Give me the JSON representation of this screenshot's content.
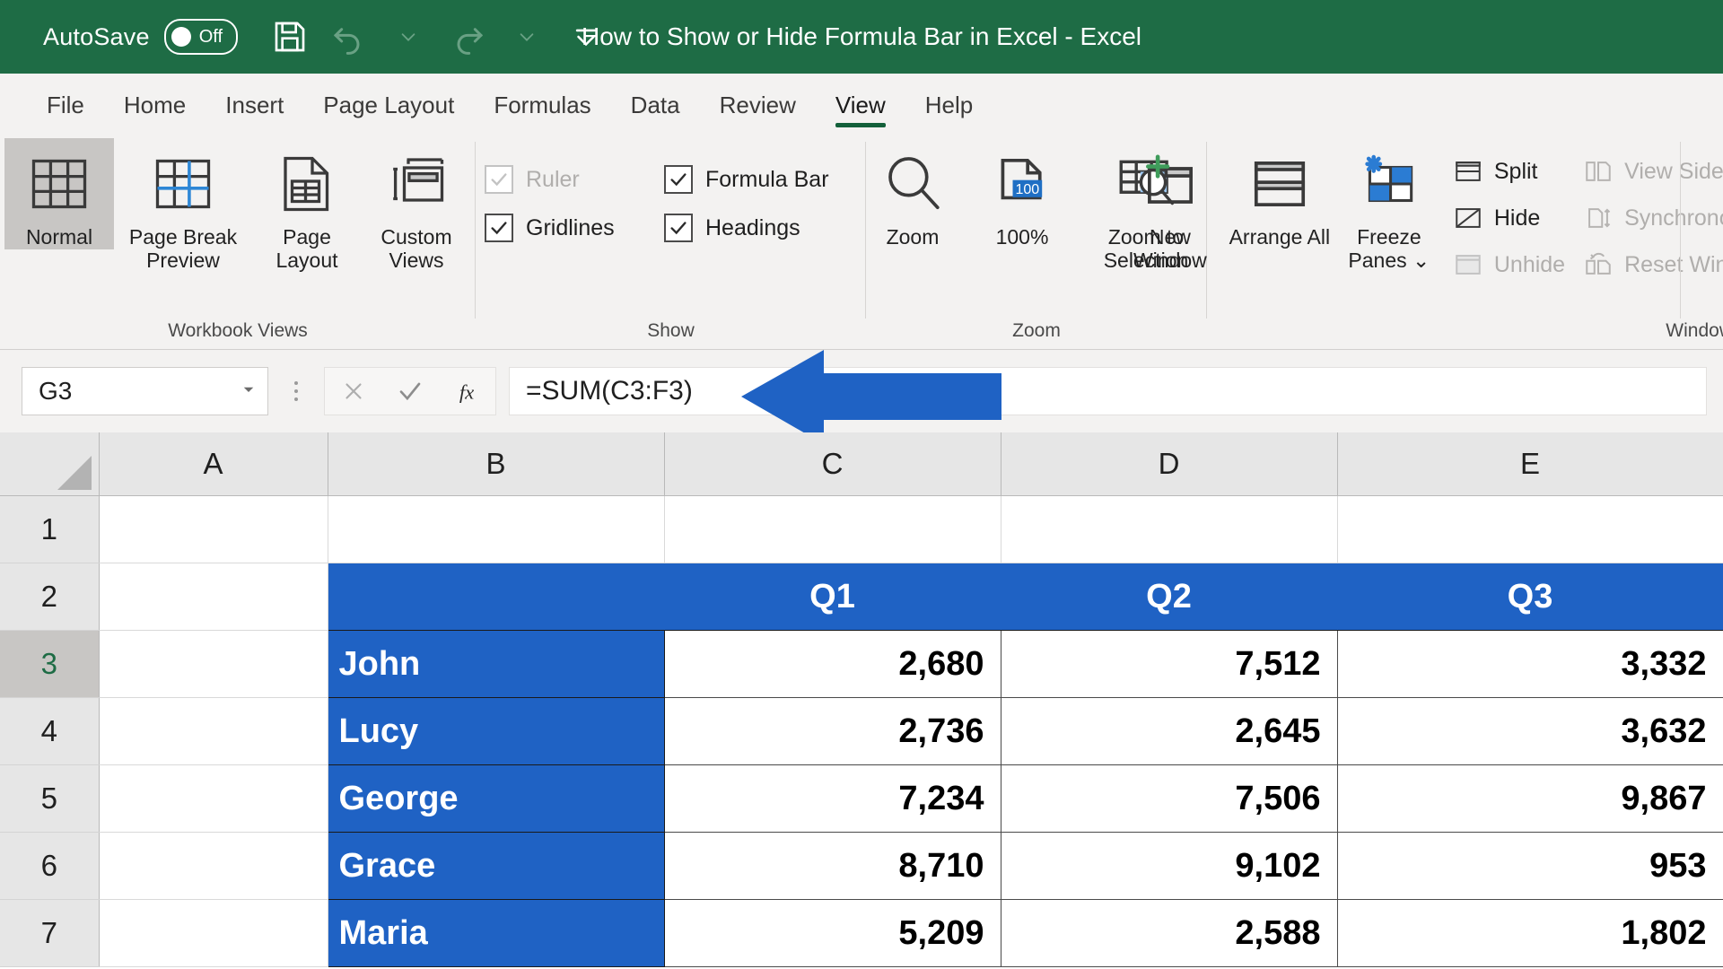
{
  "titlebar": {
    "autosave_label": "AutoSave",
    "autosave_state": "Off",
    "document_title": "How to Show or Hide Formula Bar in Excel  -  Excel",
    "quick_access": [
      {
        "name": "save-icon",
        "label": "Save"
      },
      {
        "name": "undo-icon",
        "label": "Undo"
      },
      {
        "name": "undo-dropdown-icon",
        "label": "Undo options"
      },
      {
        "name": "redo-icon",
        "label": "Redo"
      },
      {
        "name": "redo-dropdown-icon",
        "label": "Redo options"
      },
      {
        "name": "customize-quick-access-icon",
        "label": "Customize Quick Access Toolbar"
      }
    ],
    "accent_green": "#1e6c45"
  },
  "tabs": [
    {
      "label": "File",
      "active": false
    },
    {
      "label": "Home",
      "active": false
    },
    {
      "label": "Insert",
      "active": false
    },
    {
      "label": "Page Layout",
      "active": false
    },
    {
      "label": "Formulas",
      "active": false
    },
    {
      "label": "Data",
      "active": false
    },
    {
      "label": "Review",
      "active": false
    },
    {
      "label": "View",
      "active": true
    },
    {
      "label": "Help",
      "active": false
    }
  ],
  "ribbon": {
    "active_tab_underline_color": "#13603a",
    "groups": {
      "workbook_views": {
        "label": "Workbook Views",
        "buttons": [
          {
            "label": "Normal",
            "selected": true
          },
          {
            "label": "Page Break Preview",
            "selected": false
          },
          {
            "label": "Page Layout",
            "selected": false
          },
          {
            "label": "Custom Views",
            "selected": false
          }
        ]
      },
      "show": {
        "label": "Show",
        "checkboxes": [
          {
            "label": "Ruler",
            "checked": true,
            "disabled": true
          },
          {
            "label": "Formula Bar",
            "checked": true,
            "disabled": false
          },
          {
            "label": "Gridlines",
            "checked": true,
            "disabled": false
          },
          {
            "label": "Headings",
            "checked": true,
            "disabled": false
          }
        ]
      },
      "zoom": {
        "label": "Zoom",
        "buttons": [
          {
            "label": "Zoom"
          },
          {
            "label": "100%"
          },
          {
            "label": "Zoom to Selection"
          }
        ],
        "zoom_badge": "100"
      },
      "window": {
        "label": "Window",
        "big_buttons": [
          {
            "label": "New Window"
          },
          {
            "label": "Arrange All"
          },
          {
            "label": "Freeze Panes",
            "has_dropdown": true
          }
        ],
        "small_buttons": [
          {
            "label": "Split",
            "disabled": false
          },
          {
            "label": "Hide",
            "disabled": false
          },
          {
            "label": "Unhide",
            "disabled": true
          }
        ],
        "cut_off_buttons": [
          {
            "label": "View Side by Side",
            "disabled": true
          },
          {
            "label": "Synchronous Scrolling",
            "disabled": true
          },
          {
            "label": "Reset Window Position",
            "disabled": true
          }
        ]
      }
    }
  },
  "formula_bar": {
    "name_box_value": "G3",
    "cancel_label": "Cancel",
    "enter_label": "Enter",
    "insert_function_label": "Insert Function",
    "formula_value": "=SUM(C3:F3)",
    "annotation_arrow_color": "#1f62c4"
  },
  "grid": {
    "columns": [
      "A",
      "B",
      "C",
      "D",
      "E"
    ],
    "rows": [
      "1",
      "2",
      "3",
      "4",
      "5",
      "6",
      "7"
    ],
    "active_row": "3",
    "header_fill": "#1f62c4",
    "header_text_color": "#ffffff",
    "data": [
      {
        "row": "1",
        "A": "",
        "B": "",
        "C": "",
        "D": "",
        "E": "",
        "style": "empty"
      },
      {
        "row": "2",
        "A": "",
        "B": "",
        "C": "Q1",
        "D": "Q2",
        "E": "Q3",
        "style": "header"
      },
      {
        "row": "3",
        "A": "",
        "B": "John",
        "C": "2,680",
        "D": "7,512",
        "E": "3,332",
        "style": "data"
      },
      {
        "row": "4",
        "A": "",
        "B": "Lucy",
        "C": "2,736",
        "D": "2,645",
        "E": "3,632",
        "style": "data"
      },
      {
        "row": "5",
        "A": "",
        "B": "George",
        "C": "7,234",
        "D": "7,506",
        "E": "9,867",
        "style": "data"
      },
      {
        "row": "6",
        "A": "",
        "B": "Grace",
        "C": "8,710",
        "D": "9,102",
        "E": "953",
        "style": "data"
      },
      {
        "row": "7",
        "A": "",
        "B": "Maria",
        "C": "5,209",
        "D": "2,588",
        "E": "1,802",
        "style": "data"
      }
    ]
  }
}
